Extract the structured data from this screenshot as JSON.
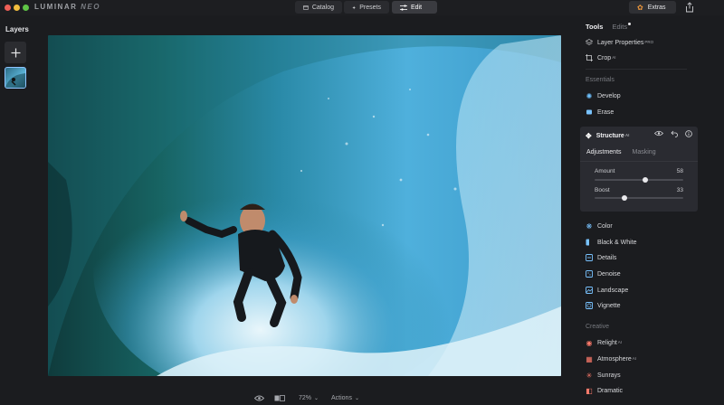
{
  "window": {
    "logo_main": "LUMINAR",
    "logo_suffix": "NEO"
  },
  "topbar": {
    "catalog": "Catalog",
    "presets": "Presets",
    "edit": "Edit",
    "extras": "Extras"
  },
  "layers": {
    "title": "Layers"
  },
  "bottom": {
    "zoom": "72%",
    "actions": "Actions"
  },
  "panel": {
    "tabs": {
      "tools": "Tools",
      "edits": "Edits"
    },
    "layer_properties": "Layer Properties",
    "layer_properties_badge": "PRO",
    "crop": "Crop",
    "crop_badge": "AI",
    "essentials_title": "Essentials",
    "develop": "Develop",
    "erase": "Erase",
    "structure": {
      "title": "Structure",
      "badge": "AI",
      "tab_adjustments": "Adjustments",
      "tab_masking": "Masking",
      "amount_label": "Amount",
      "amount_value": "58",
      "boost_label": "Boost",
      "boost_value": "33"
    },
    "sliders": {
      "amount_value": 58,
      "boost_value": 33
    },
    "color": "Color",
    "bw": "Black & White",
    "details": "Details",
    "denoise": "Denoise",
    "landscape": "Landscape",
    "vignette": "Vignette",
    "creative_title": "Creative",
    "relight": "Relight",
    "relight_badge": "AI",
    "atmosphere": "Atmosphere",
    "atmosphere_badge": "AI",
    "sunrays": "Sunrays",
    "dramatic": "Dramatic"
  },
  "colors": {
    "accent": "#8ec4ff",
    "panel_bg": "#1b1c1f",
    "active_card": "#2a2b31"
  }
}
